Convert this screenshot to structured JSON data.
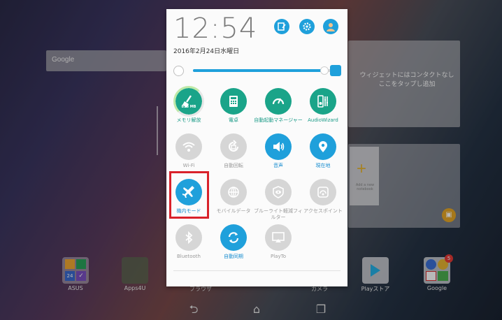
{
  "panel": {
    "time": "12:54",
    "date": "2016年2月24日水曜日",
    "brightness_level": 0.95
  },
  "tiles": [
    {
      "id": "memory",
      "label": "メモリ解放",
      "sub": "818 MB",
      "icon": "broom-icon",
      "state": "on"
    },
    {
      "id": "calculator",
      "label": "電卓",
      "icon": "calculator-icon",
      "state": "on"
    },
    {
      "id": "autostart",
      "label": "自動起動マネージャー",
      "icon": "autostart-gauge-icon",
      "state": "on"
    },
    {
      "id": "audiowizard",
      "label": "AudioWizard",
      "icon": "audio-eq-icon",
      "state": "on"
    },
    {
      "id": "wifi",
      "label": "Wi-Fi",
      "icon": "wifi-icon",
      "state": "off"
    },
    {
      "id": "autorotate",
      "label": "自動回転",
      "icon": "rotate-icon",
      "state": "off"
    },
    {
      "id": "sound",
      "label": "音声",
      "icon": "speaker-icon",
      "state": "on"
    },
    {
      "id": "location",
      "label": "現在地",
      "icon": "location-pin-icon",
      "state": "on"
    },
    {
      "id": "airplane",
      "label": "機内モード",
      "icon": "airplane-icon",
      "state": "on"
    },
    {
      "id": "mobiledata",
      "label": "モバイルデータ",
      "icon": "mobile-data-icon",
      "state": "off"
    },
    {
      "id": "bluelight",
      "label": "ブルーライト軽減フィルター",
      "icon": "eye-filter-icon",
      "state": "off"
    },
    {
      "id": "hotspot",
      "label": "アクセスポイント",
      "icon": "hotspot-icon",
      "state": "off"
    },
    {
      "id": "bluetooth",
      "label": "Bluetooth",
      "icon": "bluetooth-icon",
      "state": "off"
    },
    {
      "id": "autosync",
      "label": "自動同期",
      "icon": "sync-icon",
      "state": "on"
    },
    {
      "id": "playto",
      "label": "PlayTo",
      "icon": "cast-icon",
      "state": "off"
    }
  ],
  "home": {
    "google_bar": "Google",
    "contact_widget": "ウィジェットにはコンタクトなし\nここをタップし追加",
    "note_widget": "Add a new notebook",
    "dock": [
      {
        "label": "ASUS",
        "icon": "folder-icon"
      },
      {
        "label": "Apps4U",
        "icon": "folder-icon"
      },
      {
        "label": "ブラウザ",
        "icon": "browser-icon"
      },
      {
        "label": "カメラ",
        "icon": "camera-icon"
      },
      {
        "label": "Playストア",
        "icon": "play-store-icon"
      },
      {
        "label": "Google",
        "icon": "google-folder-icon"
      }
    ],
    "calendar_day": "24",
    "google_badge": "5"
  },
  "nav": {
    "back": "back-icon",
    "home": "home-icon",
    "recents": "recents-icon"
  }
}
